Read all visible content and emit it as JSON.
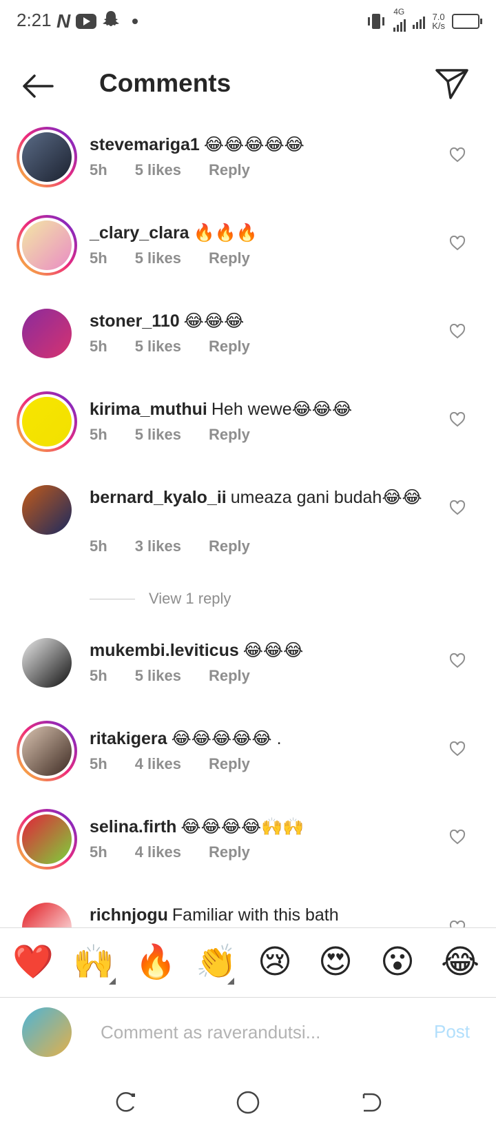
{
  "status_bar": {
    "time": "2:21",
    "network": "4G",
    "speed_value": "7.0",
    "speed_unit": "K/s",
    "icons": [
      "n-icon",
      "youtube-icon",
      "snapchat-icon",
      "dot-icon",
      "vibrate-icon",
      "signal-icon",
      "battery-icon"
    ]
  },
  "header": {
    "title": "Comments",
    "back_icon": "arrow-left-icon",
    "share_icon": "send-icon"
  },
  "comments": [
    {
      "username": "stevemariga1",
      "text": "😂😂😂😂😂",
      "time": "5h",
      "likes": "5 likes",
      "reply": "Reply",
      "ring": true,
      "avatar_colors": [
        "#5a6b86",
        "#1c2230"
      ]
    },
    {
      "username": "_clary_clara",
      "text": "🔥🔥🔥",
      "time": "5h",
      "likes": "5 likes",
      "reply": "Reply",
      "ring": true,
      "avatar_colors": [
        "#f3e7a4",
        "#e98cc4"
      ]
    },
    {
      "username": "stoner_110",
      "text": "😂😂😂",
      "time": "5h",
      "likes": "5 likes",
      "reply": "Reply",
      "ring": false,
      "avatar_colors": [
        "#8a2b9c",
        "#d63370"
      ]
    },
    {
      "username": "kirima_muthui",
      "text": "Heh wewe😂😂😂",
      "time": "5h",
      "likes": "5 likes",
      "reply": "Reply",
      "ring": true,
      "avatar_colors": [
        "#f7e600",
        "#f2e000"
      ]
    },
    {
      "username": "bernard_kyalo_ii",
      "text": "umeaza gani budah😂😂",
      "time": "5h",
      "likes": "3 likes",
      "reply": "Reply",
      "ring": false,
      "avatar_colors": [
        "#c25b1a",
        "#1b2a60"
      ]
    },
    {
      "username": "mukembi.leviticus",
      "text": "😂😂😂",
      "time": "5h",
      "likes": "5 likes",
      "reply": "Reply",
      "ring": false,
      "avatar_colors": [
        "#e9e9e9",
        "#111111"
      ]
    },
    {
      "username": "ritakigera",
      "text": "😂😂😂😂😂 .",
      "time": "5h",
      "likes": "4 likes",
      "reply": "Reply",
      "ring": true,
      "avatar_colors": [
        "#d9c3b0",
        "#3d2a22"
      ]
    },
    {
      "username": "selina.firth",
      "text": "😂😂😂😂🙌🙌",
      "time": "5h",
      "likes": "4 likes",
      "reply": "Reply",
      "ring": true,
      "avatar_colors": [
        "#e3213a",
        "#7bd33b"
      ]
    },
    {
      "username": "richnjogu",
      "text": "Familiar with this bath",
      "ring": false,
      "avatar_colors": [
        "#e21b22",
        "#ffffff"
      ]
    }
  ],
  "view_replies": "View 1 reply",
  "quick_emojis": [
    "❤️",
    "🙌",
    "🔥",
    "👏",
    "😢",
    "😍",
    "😮",
    "😂"
  ],
  "composer": {
    "placeholder": "Comment as raverandutsi...",
    "post_label": "Post",
    "avatar_colors": [
      "#4db4d6",
      "#e3b04a"
    ]
  },
  "nav_icons": [
    "recents-icon",
    "home-icon",
    "back-icon"
  ]
}
